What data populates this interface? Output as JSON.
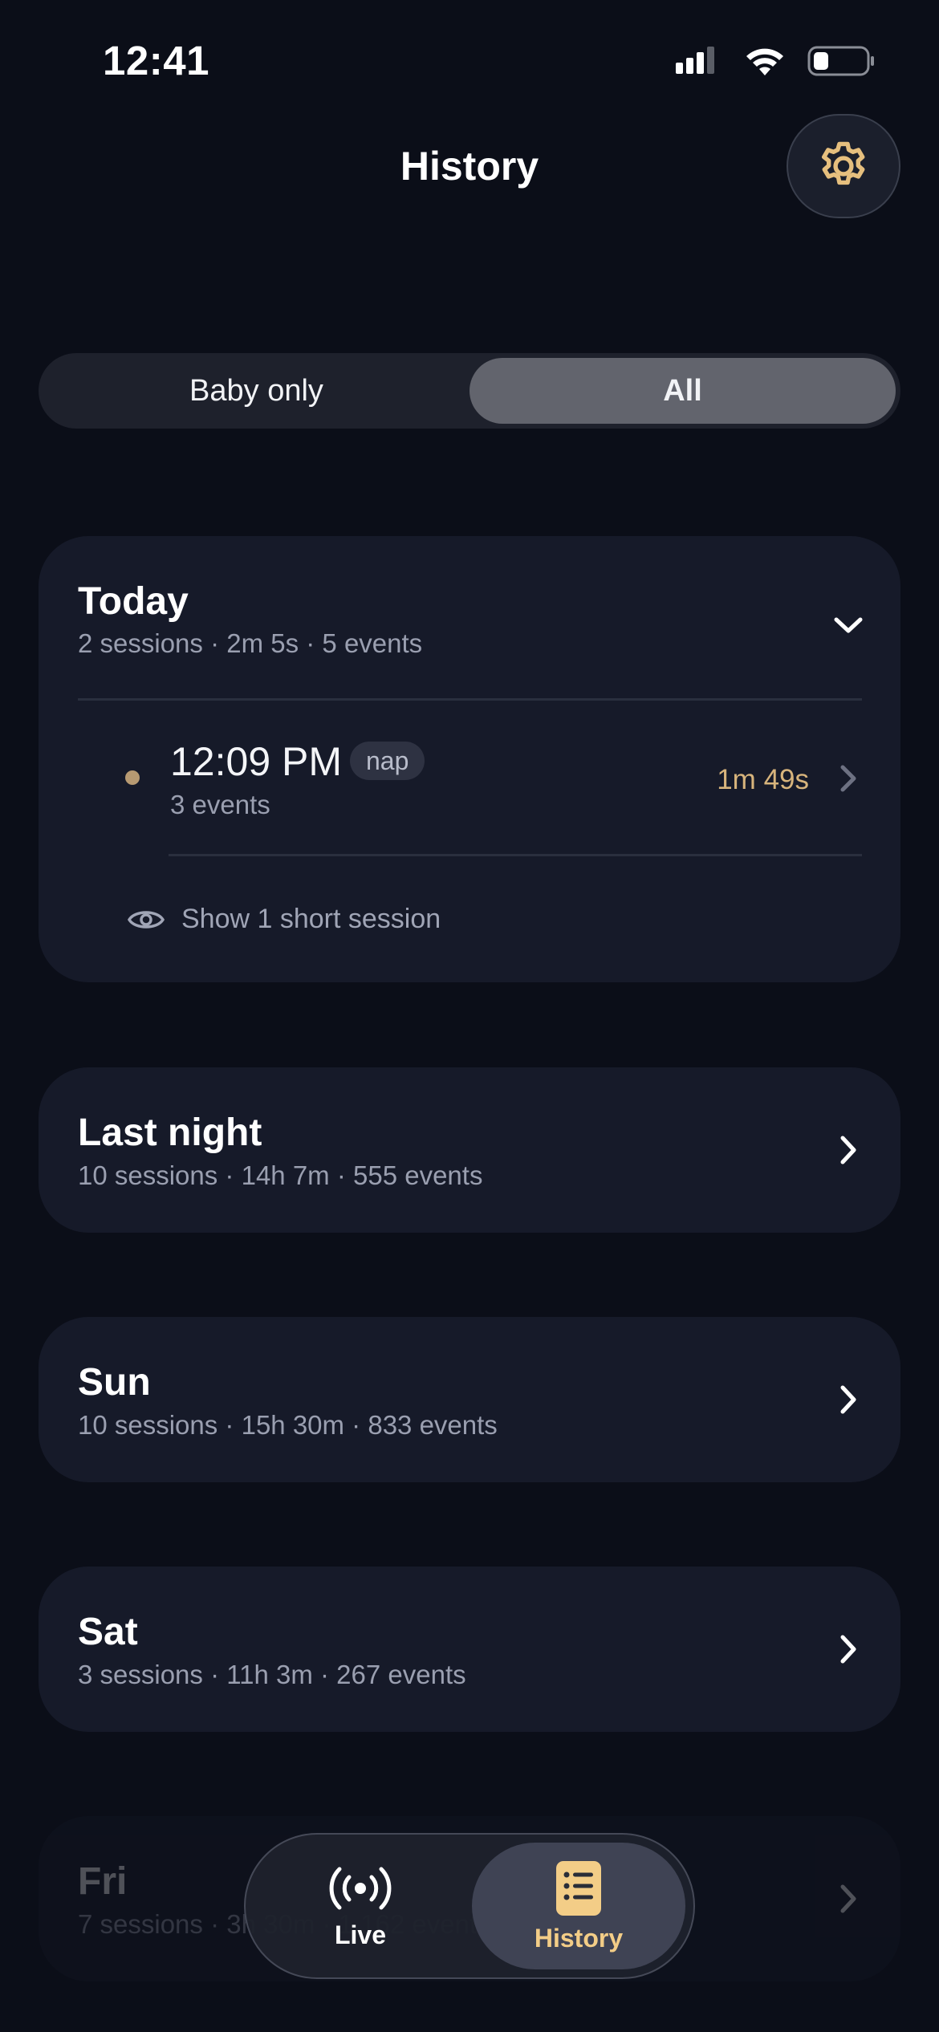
{
  "status_bar": {
    "time": "12:41"
  },
  "header": {
    "title": "History"
  },
  "segmented": {
    "options": [
      "Baby only",
      "All"
    ],
    "selected": "All"
  },
  "today": {
    "title": "Today",
    "summary": "2 sessions · 2m 5s · 5 events",
    "session": {
      "time": "12:09 PM",
      "tag": "nap",
      "events": "3 events",
      "duration": "1m 49s"
    },
    "show_short": "Show 1 short session"
  },
  "days": [
    {
      "title": "Last night",
      "summary": "10 sessions · 14h 7m · 555 events"
    },
    {
      "title": "Sun",
      "summary": "10 sessions · 15h 30m · 833 events"
    },
    {
      "title": "Sat",
      "summary": "3 sessions · 11h 3m · 267 events"
    },
    {
      "title": "Fri",
      "summary": "7 sessions · 3h 30m · 1,162 events"
    }
  ],
  "bottom_nav": {
    "items": [
      {
        "label": "Live"
      },
      {
        "label": "History"
      }
    ],
    "active": "History"
  },
  "colors": {
    "background": "#0b0e18",
    "card": "#161a29",
    "accent": "#d7b47c",
    "active_nav": "#f3cd87"
  },
  "icons": [
    "gear-icon",
    "chevron-down-icon",
    "chevron-right-icon",
    "eye-icon",
    "broadcast-icon",
    "list-document-icon"
  ]
}
